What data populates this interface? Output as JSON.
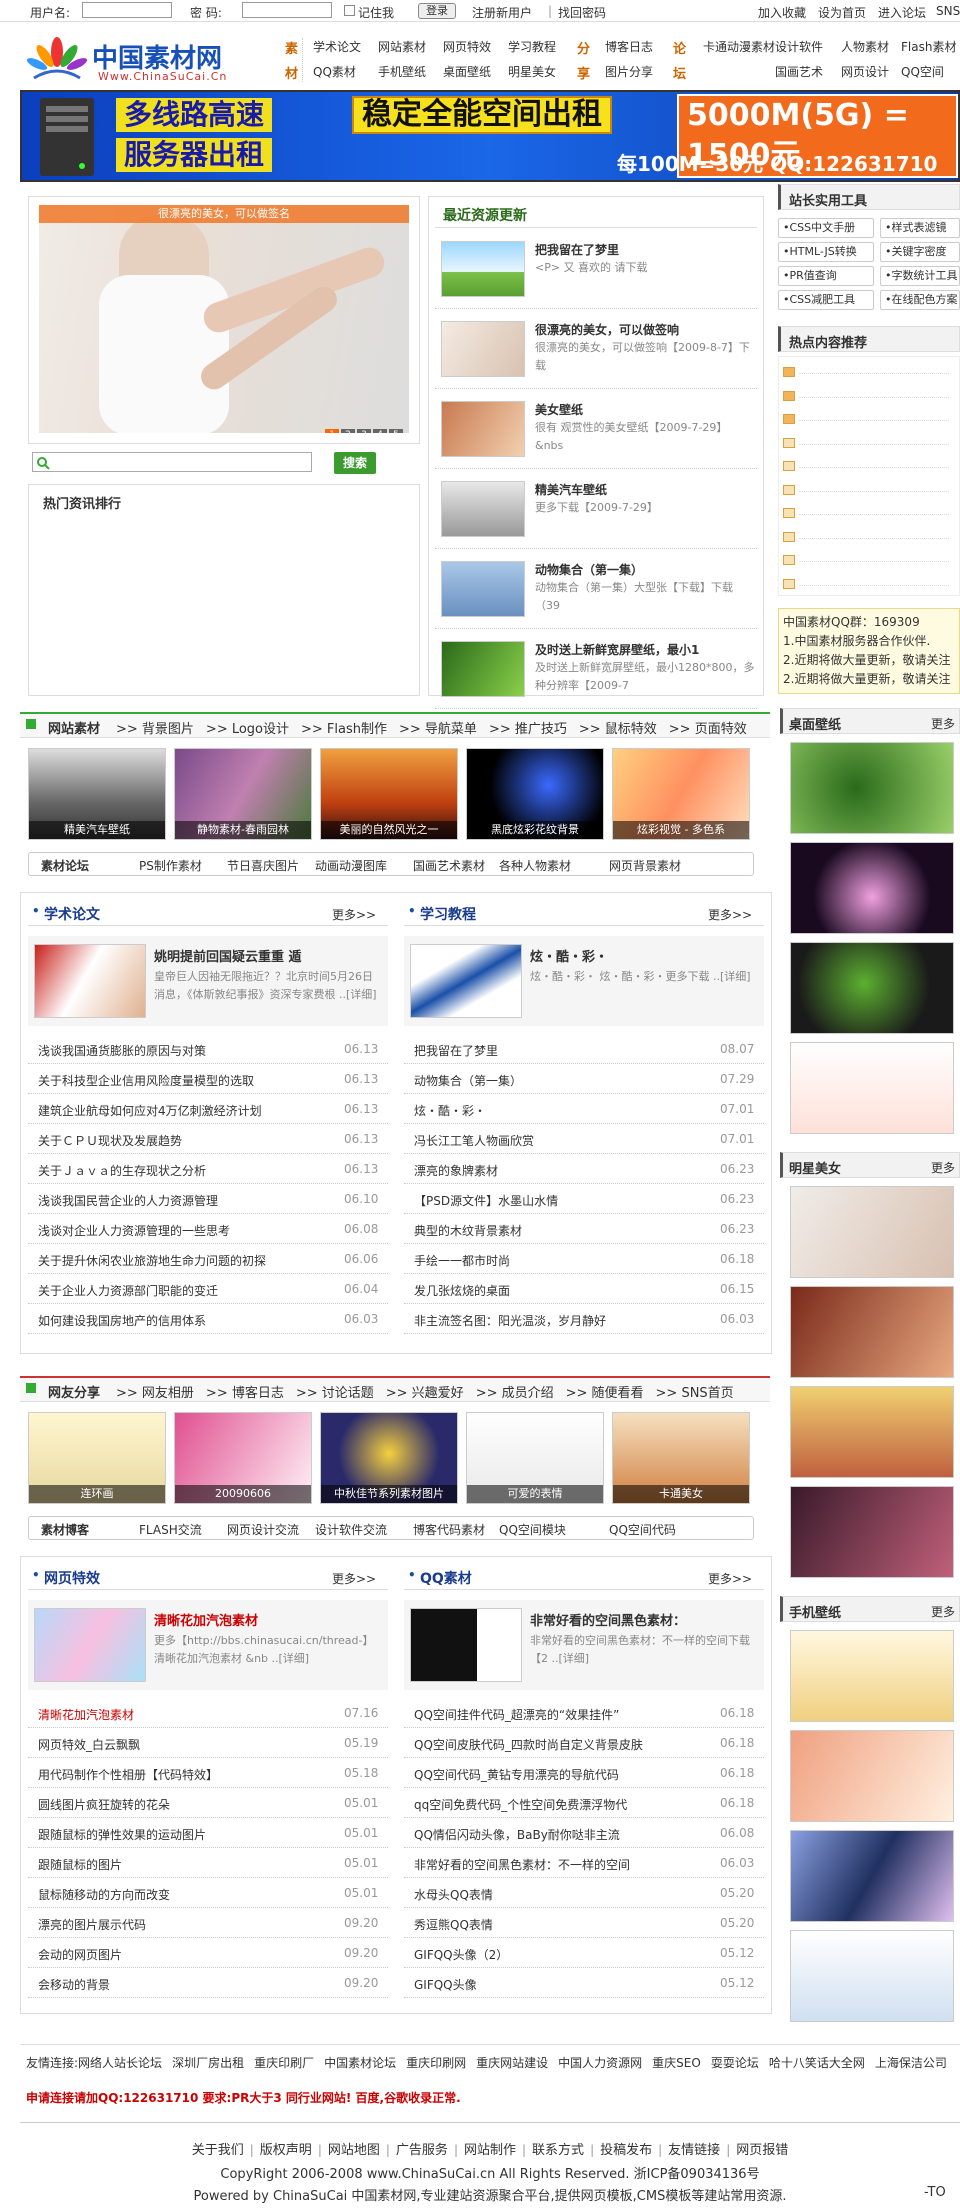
{
  "topbar": {
    "user_label": "用户名:",
    "pwd_label": "密  码:",
    "remember": "记住我",
    "login_btn": "登录",
    "register": "注册新用户",
    "forgot": "找回密码",
    "add_fav": "加入收藏",
    "set_home": "设为首页",
    "enter_forum": "进入论坛",
    "sns": "SNS"
  },
  "logo": {
    "cn": "中国素材网",
    "en": "Www.ChinaSuCai.Cn"
  },
  "nav": {
    "g1_cat": [
      "素",
      "材"
    ],
    "g1_row1": [
      "学术论文",
      "网站素材",
      "网页特效",
      "学习教程"
    ],
    "g1_row2": [
      "QQ素材",
      "手机壁纸",
      "桌面壁纸",
      "明星美女"
    ],
    "g2_cat": [
      "分",
      "享"
    ],
    "g2_row1": [
      "博客日志"
    ],
    "g2_row2": [
      "图片分享"
    ],
    "g3_cat": [
      "论",
      "坛"
    ],
    "g3_row1": [
      "卡通动漫素材",
      "设计软件",
      "人物素材",
      "Flash素材"
    ],
    "g3_row2": [
      "国画艺术",
      "网页设计",
      "QQ空间"
    ]
  },
  "banner": {
    "line1": "多线路高速",
    "line2": "服务器出租",
    "mid": "稳定全能空间出租",
    "price": "5000M(5G) = 1500元",
    "sub": "每100M=30元  QQ:122631710"
  },
  "slideshow": {
    "caption": "很漂亮的美女，可以做签名",
    "pages": [
      "1",
      "2",
      "3",
      "4",
      "5"
    ]
  },
  "search": {
    "btn": "搜索"
  },
  "hot_news": {
    "title": "热门资讯排行"
  },
  "latest": {
    "title": "最近资源更新",
    "items": [
      {
        "title": "把我留在了梦里",
        "desc": "<P> 又 喜欢的 请下载"
      },
      {
        "title": "很漂亮的美女，可以做签响",
        "desc": "很漂亮的美女，可以做签响【2009-8-7】下载"
      },
      {
        "title": "美女壁纸",
        "desc": "很有 观赏性的美女壁纸【2009-7-29】  &nbs"
      },
      {
        "title": "精美汽车壁纸",
        "desc": "更多下载【2009-7-29】"
      },
      {
        "title": "动物集合（第一集）",
        "desc": "动物集合（第一集）大型张【下载】下载（39"
      },
      {
        "title": "及时送上新鲜宽屏壁纸，最小1",
        "desc": "及时送上新鲜宽屏壁纸，最小1280*800，多种分辨率【2009-7"
      }
    ]
  },
  "tools": {
    "title": "站长实用工具",
    "items": [
      "CSS中文手册",
      "样式表滤镜",
      "HTML-JS转换",
      "关键字密度",
      "PR值查询",
      "字数统计工具",
      "CSS减肥工具",
      "在线配色方案"
    ]
  },
  "hot": {
    "title": "热点内容推荐"
  },
  "qq_notice": {
    "lines": [
      "中国素材QQ群：169309",
      "1.中国素材服务器合作伙伴.",
      "2.近期将做大量更新，敬请关注",
      "2.近期将做大量更新，敬请关注"
    ]
  },
  "web_material": {
    "title": "网站素材",
    "links": [
      ">> 背景图片",
      ">> Logo设计",
      ">> Flash制作",
      ">> 导航菜单",
      ">> 推广技巧",
      ">> 鼠标特效",
      ">> 页面特效"
    ],
    "thumbs": [
      "精美汽车壁纸",
      "静物素材-春雨园林",
      "美丽的自然风光之一",
      "黑底炫彩花纹背景",
      "炫彩视觉 - 多色系"
    ],
    "tabs": [
      "素材论坛",
      "PS制作素材",
      "节日喜庆图片",
      "动画动漫图库",
      "国画艺术素材",
      "各种人物素材",
      "网页背景素材"
    ]
  },
  "academic": {
    "title": "学术论文",
    "more": "更多>>",
    "feature_title": "姚明提前回国疑云重重 遁",
    "feature_desc": "皇帝巨人因袖无限拖近？？北京时间5月26日消息，《体斯敦纪事报》资深专家费根 ..[详细]",
    "rows": [
      [
        "浅谈我国通货膨胀的原因与对策",
        "06.13"
      ],
      [
        "关于科技型企业信用风险度量模型的选取",
        "06.13"
      ],
      [
        "建筑企业航母如何应对4万亿刺激经济计划",
        "06.13"
      ],
      [
        "关于ＣＰＵ现状及发展趋势",
        "06.13"
      ],
      [
        "关于Ｊａｖａ的生存现状之分析",
        "06.13"
      ],
      [
        "浅谈我国民营企业的人力资源管理",
        "06.10"
      ],
      [
        "浅谈对企业人力资源管理的一些思考",
        "06.08"
      ],
      [
        "关于提升休闲农业旅游地生命力问题的初探",
        "06.06"
      ],
      [
        "关于企业人力资源部门职能的变迁",
        "06.04"
      ],
      [
        "如何建设我国房地产的信用体系",
        "06.03"
      ]
    ]
  },
  "tutorial": {
    "title": "学习教程",
    "more": "更多>>",
    "feature_title": "炫・酷・彩・",
    "feature_desc": "炫・酷・彩・  炫・酷・彩・更多下载 ..[详细]",
    "rows": [
      [
        "把我留在了梦里",
        "08.07"
      ],
      [
        "动物集合（第一集）",
        "07.29"
      ],
      [
        "炫・酷・彩・",
        "07.01"
      ],
      [
        "冯长江工笔人物画欣赏",
        "07.01"
      ],
      [
        "漂亮的象牌素材",
        "06.23"
      ],
      [
        "【PSD源文件】水墨山水情",
        "06.23"
      ],
      [
        "典型的木纹背景素材",
        "06.23"
      ],
      [
        "手绘一一都市时尚",
        "06.18"
      ],
      [
        "发几张炫烧的桌面",
        "06.15"
      ],
      [
        "非主流签名图：阳光温淡，岁月静好",
        "06.03"
      ]
    ]
  },
  "friends": {
    "title": "网友分享",
    "links": [
      ">> 网友相册",
      ">> 博客日志",
      ">> 讨论话题",
      ">> 兴趣爱好",
      ">> 成员介绍",
      ">> 随便看看",
      ">> SNS首页"
    ],
    "thumbs": [
      "连环画",
      "20090606",
      "中秋佳节系列素材图片",
      "可爱的表情",
      "卡通美女"
    ],
    "tabs": [
      "素材博客",
      "FLASH交流",
      "网页设计交流",
      "设计软件交流",
      "博客代码素材",
      "QQ空间模块",
      "QQ空间代码"
    ]
  },
  "effects": {
    "title": "网页特效",
    "more": "更多>>",
    "feature_title": "清晰花加汽泡素材",
    "feature_desc": "更多【http://bbs.chinasucai.cn/thread-】清晰花加汽泡素材  &nb ..[详细]",
    "rows": [
      [
        "清晰花加汽泡素材",
        "07.16"
      ],
      [
        "网页特效_白云飘飘",
        "05.19"
      ],
      [
        "用代码制作个性相册【代码特效】",
        "05.18"
      ],
      [
        "圆线图片疯狂旋转的花朵",
        "05.01"
      ],
      [
        "跟随鼠标的弹性效果的运动图片",
        "05.01"
      ],
      [
        "跟随鼠标的图片",
        "05.01"
      ],
      [
        "鼠标随移动的方向而改变",
        "05.01"
      ],
      [
        "漂亮的图片展示代码",
        "09.20"
      ],
      [
        "会动的网页图片",
        "09.20"
      ],
      [
        "会移动的背景",
        "09.20"
      ]
    ]
  },
  "qq": {
    "title": "QQ素材",
    "more": "更多>>",
    "feature_title": "非常好看的空间黑色素材：",
    "feature_desc": "非常好看的空间黑色素材：不一样的空间下载【2 ..[详细]",
    "rows": [
      [
        "QQ空间挂件代码_超漂亮的“效果挂件”",
        "06.18"
      ],
      [
        "QQ空间皮肤代码_四款时尚自定义背景皮肤",
        "06.18"
      ],
      [
        "QQ空间代码_黄钻专用漂亮的导航代码",
        "06.18"
      ],
      [
        "qq空间免费代码_个性空间免费漂浮物代",
        "06.18"
      ],
      [
        "QQ情侣闪动头像，BaBy耐你哒非主流",
        "06.08"
      ],
      [
        "非常好看的空间黑色素材：不一样的空间",
        "06.03"
      ],
      [
        "水母头QQ表情",
        "05.20"
      ],
      [
        "秀逗熊QQ表情",
        "05.20"
      ],
      [
        "GIFQQ头像（2）",
        "05.12"
      ],
      [
        "GIFQQ头像",
        "05.12"
      ]
    ]
  },
  "side_desktop": {
    "title": "桌面壁纸",
    "more": "更多"
  },
  "side_stars": {
    "title": "明星美女",
    "more": "更多"
  },
  "side_mobile": {
    "title": "手机壁纸",
    "more": "更多"
  },
  "friendlinks": {
    "label": "友情连接:",
    "items": [
      "网络人站长论坛",
      "深圳厂房出租",
      "重庆印刷厂",
      "中国素材论坛",
      "重庆印刷网",
      "重庆网站建设",
      "中国人力资源网",
      "重庆SEO",
      "耍耍论坛",
      "哈十八笑话大全网",
      "上海保洁公司"
    ],
    "notice": "申请连接请加QQ:122631710 要求:PR大于3 同行业网站! 百度,谷歌收录正常."
  },
  "footer": {
    "links": [
      "关于我们",
      "版权声明",
      "网站地图",
      "广告服务",
      "网站制作",
      "联系方式",
      "投稿发布",
      "友情链接",
      "网页报错"
    ],
    "copyright": "CopyRight 2006-2008 www.ChinaSuCai.cn All Rights Reserved. 浙ICP备09034136号",
    "powered": "Powered by ChinaSuCai 中国素材网,专业建站资源聚合平台,提供网页模板,CMS模板等建站常用资源.",
    "corner": "-TO"
  }
}
